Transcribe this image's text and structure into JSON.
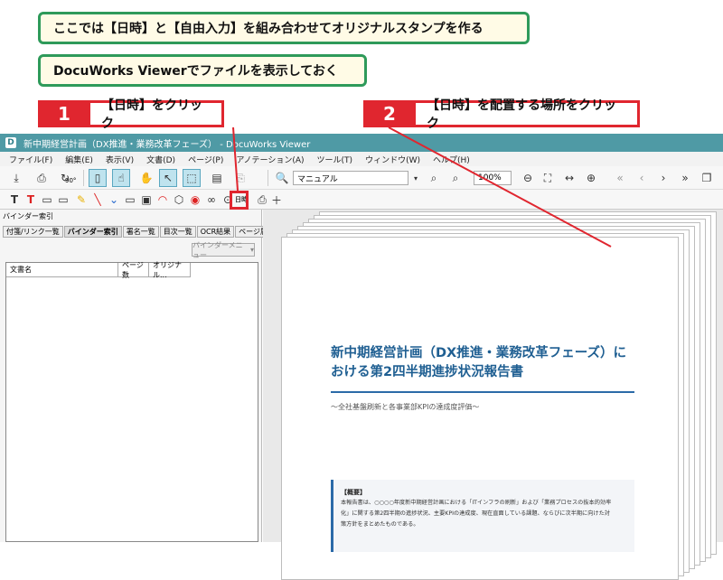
{
  "banners": {
    "top1": "ここでは【日時】と【自由入力】を組み合わせてオリジナルスタンプを作る",
    "top2": "DocuWorks Viewerでファイルを表示しておく"
  },
  "steps": [
    {
      "num": "1",
      "text": "【日時】をクリック"
    },
    {
      "num": "2",
      "text": "【日時】を配置する場所をクリック"
    }
  ],
  "window": {
    "title": "新中期経営計画（DX推進・業務改革フェーズ） - DocuWorks Viewer",
    "menu": [
      "ファイル(F)",
      "編集(E)",
      "表示(V)",
      "文書(D)",
      "ページ(P)",
      "アノテーション(A)",
      "ツール(T)",
      "ウィンドウ(W)",
      "ヘルプ(H)"
    ],
    "view_mode": "マニュアル",
    "zoom": "100%",
    "rotate_label": "90°",
    "tooltip": "日時"
  },
  "left_panel": {
    "title": "バインダー索引",
    "tabs": [
      "付箋/リンク一覧",
      "バインダー索引",
      "署名一覧",
      "目次一覧",
      "OCR結果",
      "ページ属性"
    ],
    "binder_menu": "バインダーメニュー",
    "columns": [
      "文書名",
      "ページ数",
      "オリジナル..."
    ]
  },
  "document": {
    "title_line1": "新中期経営計画（DX推進・業務改革フェーズ）に",
    "title_line2": "おける第2四半期進捗状況報告書",
    "subtitle": "〜全社基盤刷新と各事業部KPIの達成度評価〜",
    "summary_heading": "【概要】",
    "summary_lines": [
      "本報告書は、○○○○年度新中期経営計画における「ITインフラの刷新」および「業務プロセスの抜本的効率",
      "化」に関する第2四半期の進捗状況、主要KPIの達成度、現在直面している課題、ならびに次半期に向けた対",
      "策方針をまとめたものである。"
    ]
  },
  "colors": {
    "banner_border": "#2e9a5a",
    "banner_fill": "#fffbe6",
    "step_red": "#e0262f",
    "titlebar": "#4f9aa5",
    "doc_title": "#1f5f92"
  }
}
